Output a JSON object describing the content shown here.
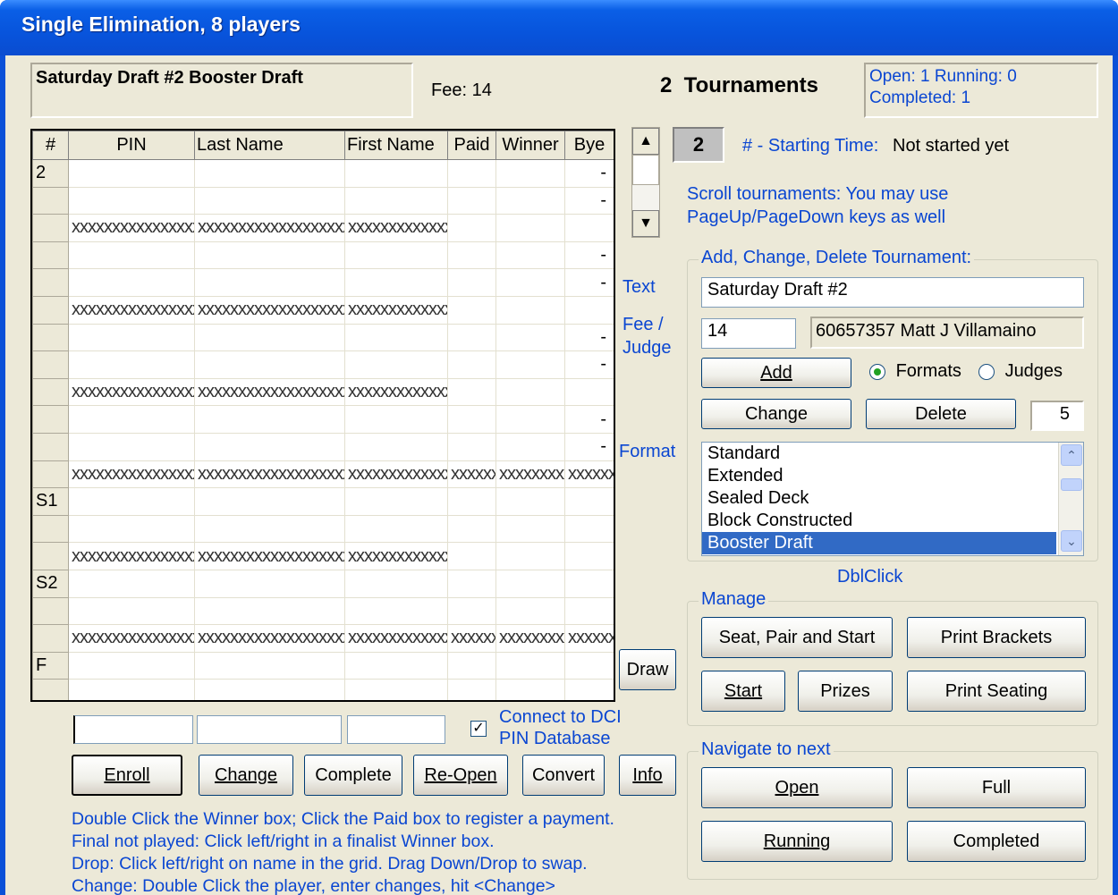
{
  "window": {
    "title": "Single Elimination, 8 players"
  },
  "header": {
    "tournament_name": "Saturday Draft #2 Booster Draft",
    "fee_label": "Fee: 14",
    "count_label": "2  Tournaments",
    "status_line1": "Open: 1  Running: 0",
    "status_line2": "Completed:  1"
  },
  "grid": {
    "columns": [
      "#",
      "PIN",
      "Last Name",
      "First Name",
      "Paid",
      "Winner",
      "Bye"
    ],
    "row_labels": [
      "2",
      "",
      "",
      "",
      "",
      "",
      "",
      "",
      "",
      "",
      "",
      "",
      "",
      "S1",
      "",
      "",
      "S2",
      "",
      "",
      "F",
      ""
    ],
    "separator_text": "xxxxxxxxxxxxxxxxxxxxxxxxxxxxxxxxxxxxxxxxxxxxx",
    "short_separator": "xxxxxxxxxxxxxxxxxxxxxx",
    "bye_dash": "-"
  },
  "scroll": {
    "current_number": "2",
    "starting_time_label": "# - Starting Time:",
    "starting_time_value": "Not started yet",
    "hint_line1": "Scroll tournaments: You may use",
    "hint_line2": "PageUp/PageDown keys as well"
  },
  "side_labels": {
    "text": "Text",
    "fee": "Fee /",
    "judge": "Judge",
    "format": "Format",
    "dblclick": "DblClick"
  },
  "edit": {
    "legend": "Add, Change, Delete Tournament:",
    "text_value": "Saturday Draft #2",
    "fee_value": "14",
    "judge_value": "60657357 Matt J Villamaino",
    "add": "Add",
    "formats": "Formats",
    "judges": "Judges",
    "change": "Change",
    "delete": "Delete",
    "count_box": "5",
    "formats_list": [
      "Standard",
      "Extended",
      "Sealed Deck",
      "Block Constructed",
      "Booster Draft"
    ],
    "selected_format": "Booster Draft"
  },
  "manage": {
    "legend": "Manage",
    "seat_pair_start": "Seat, Pair and Start",
    "print_brackets": "Print Brackets",
    "start": "Start",
    "prizes": "Prizes",
    "print_seating": "Print Seating"
  },
  "navigate": {
    "legend": "Navigate to next",
    "open": "Open",
    "full": "Full",
    "running": "Running",
    "completed": "Completed"
  },
  "bottom": {
    "draw": "Draw",
    "connect_line1": "Connect to DCI",
    "connect_line2": "PIN Database",
    "connect_checked": true,
    "enroll": "Enroll",
    "change": "Change",
    "complete": "Complete",
    "reopen": "Re-Open",
    "convert": "Convert",
    "info": "Info",
    "help1": "Double Click the Winner box; Click the Paid box to register a payment.",
    "help2": "Final not played: Click left/right in a finalist Winner box.",
    "help3": "Drop: Click left/right on name in the grid. Drag Down/Drop to swap.",
    "help4": "Change: Double Click the player, enter changes, hit <Change>"
  },
  "colors": {
    "titlebar": "#0A5FE6",
    "face": "#ECE9D8",
    "label_blue": "#0A46D2",
    "selection": "#316AC5"
  }
}
